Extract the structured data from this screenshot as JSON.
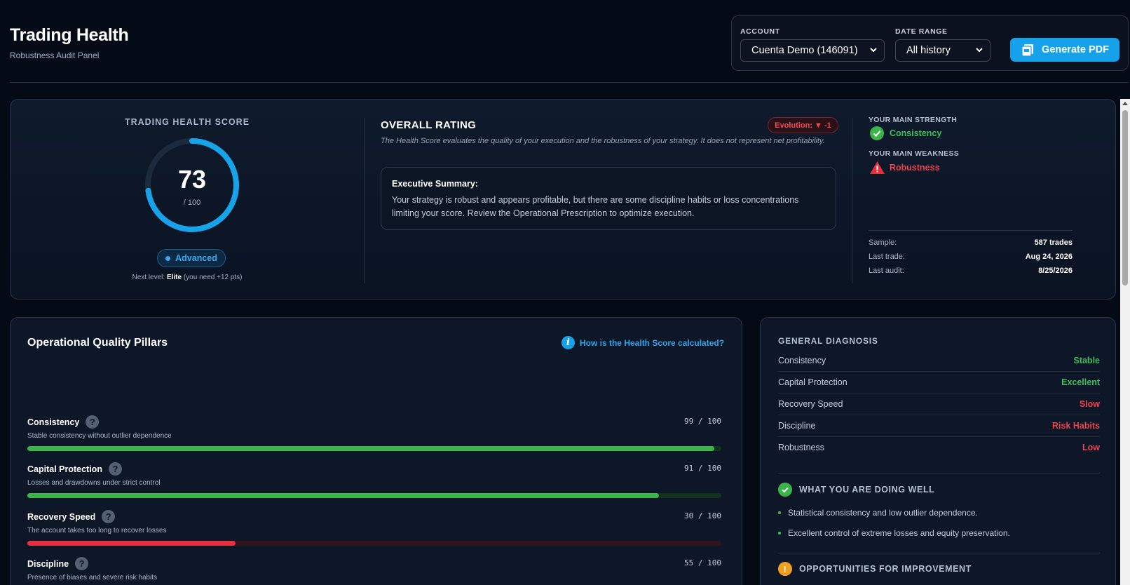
{
  "header": {
    "title": "Trading Health",
    "subtitle": "Robustness Audit Panel",
    "account_label": "ACCOUNT",
    "account_value": "Cuenta Demo (146091)",
    "date_label": "DATE RANGE",
    "date_value": "All history",
    "pdf_label": "Generate PDF"
  },
  "score": {
    "title": "TRADING HEALTH SCORE",
    "value": "73",
    "value_num": 73,
    "max_label": "/ 100",
    "max_num": 100,
    "level": "Advanced",
    "next_level_prefix": "Next level:",
    "next_level_name": "Elite",
    "next_level_suffix": "(you need +12 pts)"
  },
  "rating": {
    "title": "OVERALL RATING",
    "evolution": "Evolution: ▼ -1",
    "description": "The Health Score evaluates the quality of your execution and the robustness of your strategy. It does not represent net profitability.",
    "summary_title": "Executive Summary:",
    "summary_text": "Your strategy is robust and appears profitable, but there are some discipline habits or loss concentrations limiting your score. Review the Operational Prescription to optimize execution."
  },
  "highlights": {
    "strength_label": "YOUR MAIN STRENGTH",
    "strength_value": "Consistency",
    "weakness_label": "YOUR MAIN WEAKNESS",
    "weakness_value": "Robustness",
    "meta": [
      {
        "key": "Sample:",
        "value": "587 trades"
      },
      {
        "key": "Last trade:",
        "value": "Aug 24, 2026"
      },
      {
        "key": "Last audit:",
        "value": "8/25/2026"
      }
    ]
  },
  "pillars": {
    "title": "Operational Quality Pillars",
    "help_link": "How is the Health Score calculated?",
    "items": [
      {
        "name": "Consistency",
        "desc": "Stable consistency without outlier dependence",
        "score": "99 / 100",
        "value": 99,
        "color": "#3bb54a",
        "track": "#14301f"
      },
      {
        "name": "Capital Protection",
        "desc": "Losses and drawdowns under strict control",
        "score": "91 / 100",
        "value": 91,
        "color": "#3bb54a",
        "track": "#14301f"
      },
      {
        "name": "Recovery Speed",
        "desc": "The account takes too long to recover losses",
        "score": "30 / 100",
        "value": 30,
        "color": "#e5313f",
        "track": "#2e141b"
      },
      {
        "name": "Discipline",
        "desc": "Presence of biases and severe risk habits",
        "score": "55 / 100",
        "value": 55,
        "color": "#f0a020",
        "track": "#2e2414"
      }
    ]
  },
  "diagnosis": {
    "title": "GENERAL DIAGNOSIS",
    "rows": [
      {
        "key": "Consistency",
        "value": "Stable",
        "color": "#3bbf5c"
      },
      {
        "key": "Capital Protection",
        "value": "Excellent",
        "color": "#3bbf5c"
      },
      {
        "key": "Recovery Speed",
        "value": "Slow",
        "color": "#f04050"
      },
      {
        "key": "Discipline",
        "value": "Risk Habits",
        "color": "#f04050"
      },
      {
        "key": "Robustness",
        "value": "Low",
        "color": "#f04050"
      }
    ],
    "doing_well_title": "WHAT YOU ARE DOING WELL",
    "doing_well": [
      "Statistical consistency and low outlier dependence.",
      "Excellent control of extreme losses and equity preservation."
    ],
    "improve_title": "OPPORTUNITIES FOR IMPROVEMENT"
  },
  "colors": {
    "accent": "#15a2ea",
    "good": "#3bbf5c",
    "bad": "#f04050",
    "warn": "#f0a020"
  }
}
